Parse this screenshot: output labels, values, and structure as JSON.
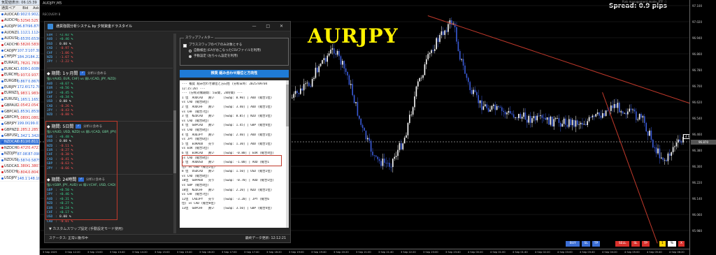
{
  "market_watch": {
    "title": "気配値表示: 06:15:39",
    "col_symbol": "通貨ペア",
    "col_bid": "Bid",
    "col_ask": "Ask",
    "rows": [
      {
        "sym": "AUDCAD",
        "bid": "0.90213",
        "ask": "0.90224",
        "dir": "up",
        "sel": false
      },
      {
        "sym": "AUDCHF",
        "bid": "0.52565",
        "ask": "0.52574",
        "dir": "dn",
        "sel": false
      },
      {
        "sym": "AUDJPY",
        "bid": "96.870",
        "ask": "96.879",
        "dir": "up",
        "sel": false
      },
      {
        "sym": "AUDNZD",
        "bid": "1.11226",
        "ask": "1.11240",
        "dir": "up",
        "sel": false
      },
      {
        "sym": "AUDUSD",
        "bid": "0.65352",
        "ask": "0.65360",
        "dir": "up",
        "sel": false
      },
      {
        "sym": "CADCHF",
        "bid": "0.58287",
        "ask": "0.58301",
        "dir": "dn",
        "sel": false
      },
      {
        "sym": "CADJPY",
        "bid": "107.376",
        "ask": "107.389",
        "dir": "up",
        "sel": false
      },
      {
        "sym": "CHFJPY",
        "bid": "184.204",
        "ask": "184.224",
        "dir": "up",
        "sel": false
      },
      {
        "sym": "EURAUD",
        "bid": "1.78286",
        "ask": "1.78303",
        "dir": "dn",
        "sel": false
      },
      {
        "sym": "EURCAD",
        "bid": "1.60849",
        "ask": "1.60866",
        "dir": "up",
        "sel": false
      },
      {
        "sym": "EURCHF",
        "bid": "0.93722",
        "ask": "0.93734",
        "dir": "dn",
        "sel": false
      },
      {
        "sym": "EURGBP",
        "bid": "0.86772",
        "ask": "0.86780",
        "dir": "up",
        "sel": false
      },
      {
        "sym": "EURJPY",
        "bid": "172.697",
        "ask": "172.708",
        "dir": "up",
        "sel": false
      },
      {
        "sym": "EURNZD",
        "bid": "1.98316",
        "ask": "1.98348",
        "dir": "dn",
        "sel": false
      },
      {
        "sym": "EURUSD",
        "bid": "1.16534",
        "ask": "1.16539",
        "dir": "up",
        "sel": false
      },
      {
        "sym": "GBPAUD",
        "bid": "2.05455",
        "ask": "2.05479",
        "dir": "dn",
        "sel": false
      },
      {
        "sym": "GBPCAD",
        "bid": "1.85361",
        "ask": "1.85381",
        "dir": "up",
        "sel": false
      },
      {
        "sym": "GBPCHF",
        "bid": "1.08007",
        "ask": "1.08022",
        "dir": "dn",
        "sel": false
      },
      {
        "sym": "GBPJPY",
        "bid": "199.005",
        "ask": "199.019",
        "dir": "up",
        "sel": false
      },
      {
        "sym": "GBPNZD",
        "bid": "2.28538",
        "ask": "2.28572",
        "dir": "dn",
        "sel": false
      },
      {
        "sym": "GBPUSD",
        "bid": "1.34277",
        "ask": "1.34285",
        "dir": "up",
        "sel": false
      },
      {
        "sym": "NZDCAD",
        "bid": "0.81100",
        "ask": "0.81118",
        "dir": "up",
        "sel": true
      },
      {
        "sym": "NZDCHF",
        "bid": "0.47256",
        "ask": "0.47271",
        "dir": "dn",
        "sel": false
      },
      {
        "sym": "NZDJPY",
        "bid": "87.081",
        "ask": "87.098",
        "dir": "up",
        "sel": false
      },
      {
        "sym": "NZDUSD",
        "bid": "0.58748",
        "ask": "0.58759",
        "dir": "up",
        "sel": false
      },
      {
        "sym": "USDCAD",
        "bid": "1.38062",
        "ask": "1.38076",
        "dir": "dn",
        "sel": false
      },
      {
        "sym": "USDCHF",
        "bid": "0.80424",
        "ask": "0.80434",
        "dir": "dn",
        "sel": false
      },
      {
        "sym": "USDJPY",
        "bid": "148.178",
        "ask": "148.187",
        "dir": "up",
        "sel": false
      }
    ]
  },
  "chart": {
    "title": "AUDJPY,M5",
    "indicator": "RECOVERY B",
    "symbol_overlay": "AURJPY",
    "spread_text": "Spread: 0.9 pips",
    "risk_text": "Risk management mode: RTF ⓘ",
    "entry_label": "4 tick 27 pips",
    "prices": [
      "97.100",
      "97.020",
      "96.940",
      "96.860",
      "96.780",
      "96.700",
      "96.620",
      "96.540",
      "96.460",
      "96.380",
      "96.300",
      "96.220",
      "96.140",
      "96.060",
      "95.980"
    ],
    "current_price": "96.870",
    "times": [
      "3 Sep 2025",
      "3 Sep 12:20",
      "3 Sep 13:00",
      "3 Sep 13:40",
      "3 Sep 14:20",
      "3 Sep 15:00",
      "3 Sep 15:40",
      "3 Sep 16:20",
      "3 Sep 17:00",
      "3 Sep 17:40",
      "3 Sep 18:20",
      "3 Sep 19:00",
      "3 Sep 19:40",
      "3 Sep 20:20",
      "3 Sep 21:00",
      "3 Sep 21:40",
      "3 Sep 22:20",
      "3 Sep 23:00",
      "3 Sep 23:40",
      "4 Sep 00:20",
      "4 Sep 01:00",
      "4 Sep 01:40",
      "4 Sep 02:20",
      "4 Sep 03:00",
      "4 Sep 03:40",
      "4 Sep 04:20",
      "4 Sep 05:00",
      "4 Sep 05:40",
      "4 Sep 06:20"
    ],
    "buttons": {
      "buy": "BUY",
      "sl": "SL",
      "tp": "TP",
      "sell": "SELL",
      "lot": "1",
      "pct": "%",
      "x": "X"
    }
  },
  "panel": {
    "title": "通貨強弱分析システム by 夕刻資金ドラスタイル",
    "win_buttons": "— □ ✕",
    "top_ranks": [
      {
        "cur": "EUR",
        "val": "+2.02 %",
        "c": "g"
      },
      {
        "cur": "AUD",
        "val": "+0.46 %",
        "c": "g"
      },
      {
        "cur": "USD",
        "val": "0.00 %",
        "c": "w"
      },
      {
        "cur": "CAD",
        "val": "-0.97 %",
        "c": "rd"
      },
      {
        "cur": "CHF",
        "val": "-1.06 %",
        "c": "rd"
      },
      {
        "cur": "NZD",
        "val": "-1.67 %",
        "c": "rd"
      },
      {
        "cur": "JPY",
        "val": "-2.22 %",
        "c": "rd"
      }
    ],
    "sections": [
      {
        "title": "期間: 1ヶ月間",
        "hint": "分析に含める",
        "pairs": "強い(AUD, EUR, CHF) vs 弱い(CAD, JPY, NZD)",
        "ranks": [
          {
            "cur": "AUD",
            "val": "+0.67 %",
            "c": "g"
          },
          {
            "cur": "EUR",
            "val": "+0.56 %",
            "c": "g"
          },
          {
            "cur": "GBP",
            "val": "+0.45 %",
            "c": "g"
          },
          {
            "cur": "CHF",
            "val": "+0.34 %",
            "c": "g"
          },
          {
            "cur": "USD",
            "val": "0.00 %",
            "c": "w"
          },
          {
            "cur": "CAD",
            "val": "-0.26 %",
            "c": "rd"
          },
          {
            "cur": "JPY",
            "val": "-0.43 %",
            "c": "rd"
          },
          {
            "cur": "NZD",
            "val": "-0.88 %",
            "c": "rd"
          }
        ]
      },
      {
        "title": "期間: 5日間",
        "hint": "分析に含める",
        "pairs": "強い(AUD, USD, NZD) vs 弱い(CAD, GBP, JPY)",
        "ranks": [
          {
            "cur": "AUD",
            "val": "+0.48 %",
            "c": "g"
          },
          {
            "cur": "USD",
            "val": "0.00 %",
            "c": "w"
          },
          {
            "cur": "NZD",
            "val": "-0.11 %",
            "c": "rd"
          },
          {
            "cur": "EUR",
            "val": "-0.27 %",
            "c": "rd"
          },
          {
            "cur": "CHF",
            "val": "-0.38 %",
            "c": "rd"
          },
          {
            "cur": "CAD",
            "val": "-0.41 %",
            "c": "rd"
          },
          {
            "cur": "GBP",
            "val": "-0.63 %",
            "c": "rd"
          },
          {
            "cur": "JPY",
            "val": "-0.66 %",
            "c": "rd"
          }
        ]
      },
      {
        "title": "期間: 24時間",
        "hint": "分析に含める",
        "pairs": "強い(GBP, JPY, AUD) vs 弱い(CHF, USD, CAD)",
        "ranks": [
          {
            "cur": "GBP",
            "val": "+0.50 %",
            "c": "g"
          },
          {
            "cur": "JPY",
            "val": "+0.46 %",
            "c": "g"
          },
          {
            "cur": "AUD",
            "val": "+0.31 %",
            "c": "g"
          },
          {
            "cur": "NZD",
            "val": "+0.27 %",
            "c": "g"
          },
          {
            "cur": "EUR",
            "val": "+0.24 %",
            "c": "g"
          },
          {
            "cur": "CHF",
            "val": "+0.17 %",
            "c": "g"
          },
          {
            "cur": "USD",
            "val": "0.00 %",
            "c": "w"
          },
          {
            "cur": "CAD",
            "val": "-0.01 %",
            "c": "rd"
          }
        ]
      }
    ],
    "custom_label": "▼ カスタムスワップ設定 (手動設定モード使用)",
    "status_left": "ステータス: 正常に動作中",
    "status_right": "最終データ更新: 12:12:21",
    "swap_legend": "スワップフィルター",
    "swap_check": "プラススワップのペアのみ対象とする",
    "swap_opt1": "自動検出 (EAがおこなったCSVファイルを利用)",
    "swap_opt2": "手動設定 (左ちゃん設定を利用)",
    "go_button": "推奨 組み合わせ順位と方向性",
    "result_lines": [
      "--- 推奨 組み合わせ順位と方向性 (分析日時: 2025/09/04",
      "12:15:20) ---",
      "--- (分析対象期間: 5日間, 24時間) ---",
      "",
      "1 位  AUDCAD   買い     [Swap: 0.90] | AUD (総合1位)",
      "vs CAD (総合8位)",
      "2 位  AUDCHF   買い     [Swap: 3.40] | AUD (総合1位)",
      "vs CHF (総合7位)",
      "3 位  NZDCAD   買い     [Swap: 0.05] | NZD (総合3位)",
      "vs CAD (総合8位)",
      "4 位  GBPCAD   買い     [Swap: 1.45] | GBP (総合4位)",
      "vs CAD (総合8位)",
      "4 位  AUDJPY   買い     [Swap: 2.40] | AUD (総合1位)",
      "vs JPY (総合6位)",
      "5 位  EURAUD   売り     [Swap: 1.30] | AUD (総合1位)",
      "vs EUR (総合5位)",
      "6 位  EURCAD   買い     [Swap: -0.80] | EUR (総合4位)",
      "vs CAD (総合8位)",
      "6 位  AUDUSD   買い     [Swap: -1.00] | AUD (総合1",
      "位) vs USD (総合2位)",
      "8 位  USDCAD   買い     [Swap: 1.50] | USD (総合2位)",
      "vs CAD (総合8位)",
      "10位  GBPAUD   売り     [Swap: -0.70] | AUD (総合1位)",
      "vs GBP (総合4位)",
      "10位  NZDCHF   買い     [Swap: 2.20] | NZD (総合2位)",
      "vs CHF (総合7位)",
      "12位  CADJPY   売り     [Swap: -3.20] | JPY (総合6",
      "位) vs CAD (総合8位)",
      "13位  GBPCHF   買い     [Swap: 3.50] | GBP (総合4位)"
    ]
  }
}
